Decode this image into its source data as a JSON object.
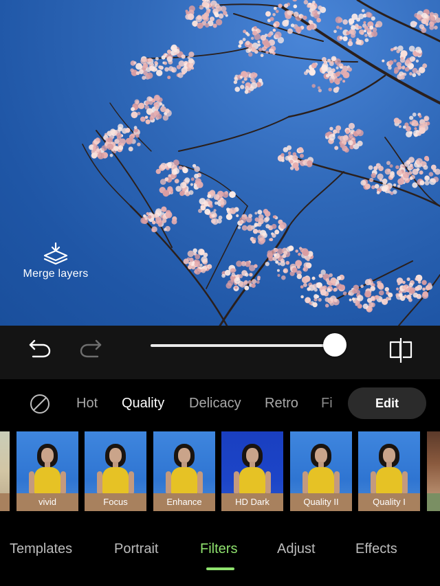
{
  "photo": {
    "merge_layers_label": "Merge layers"
  },
  "controls": {
    "undo_icon": "undo-icon",
    "redo_icon": "redo-icon",
    "compare_icon": "compare-icon",
    "intensity": 1.0
  },
  "categories": {
    "none_icon": "no-filter-icon",
    "items": [
      {
        "label": "Hot"
      },
      {
        "label": "Quality"
      },
      {
        "label": "Delicacy"
      },
      {
        "label": "Retro"
      },
      {
        "label": "Fi"
      }
    ],
    "active": "Quality",
    "edit_label": "Edit"
  },
  "thumbnails": [
    {
      "label": "vivid"
    },
    {
      "label": "Focus"
    },
    {
      "label": "Enhance"
    },
    {
      "label": "HD Dark"
    },
    {
      "label": "Quality II"
    },
    {
      "label": "Quality I"
    }
  ],
  "tabs": {
    "items": [
      {
        "label": "Templates"
      },
      {
        "label": "Portrait"
      },
      {
        "label": "Filters"
      },
      {
        "label": "Adjust"
      },
      {
        "label": "Effects"
      }
    ],
    "active": "Filters"
  },
  "colors": {
    "accent": "#8fe36e",
    "label_bg": "#a8815e",
    "sky": "#2f68b8"
  }
}
